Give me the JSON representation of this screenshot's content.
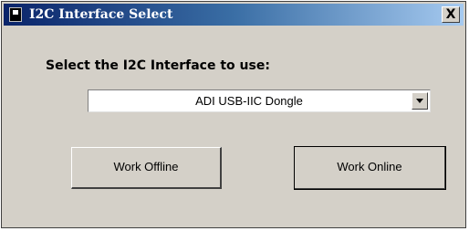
{
  "window": {
    "title": "I2C Interface Select",
    "close_label": "X"
  },
  "prompt": "Select the I2C Interface to use:",
  "interface_select": {
    "selected": "ADI USB-IIC Dongle"
  },
  "buttons": {
    "work_offline": "Work Offline",
    "work_online": "Work Online"
  },
  "icons": {
    "app": "app-icon",
    "close": "close-icon",
    "dropdown": "chevron-down-icon"
  }
}
